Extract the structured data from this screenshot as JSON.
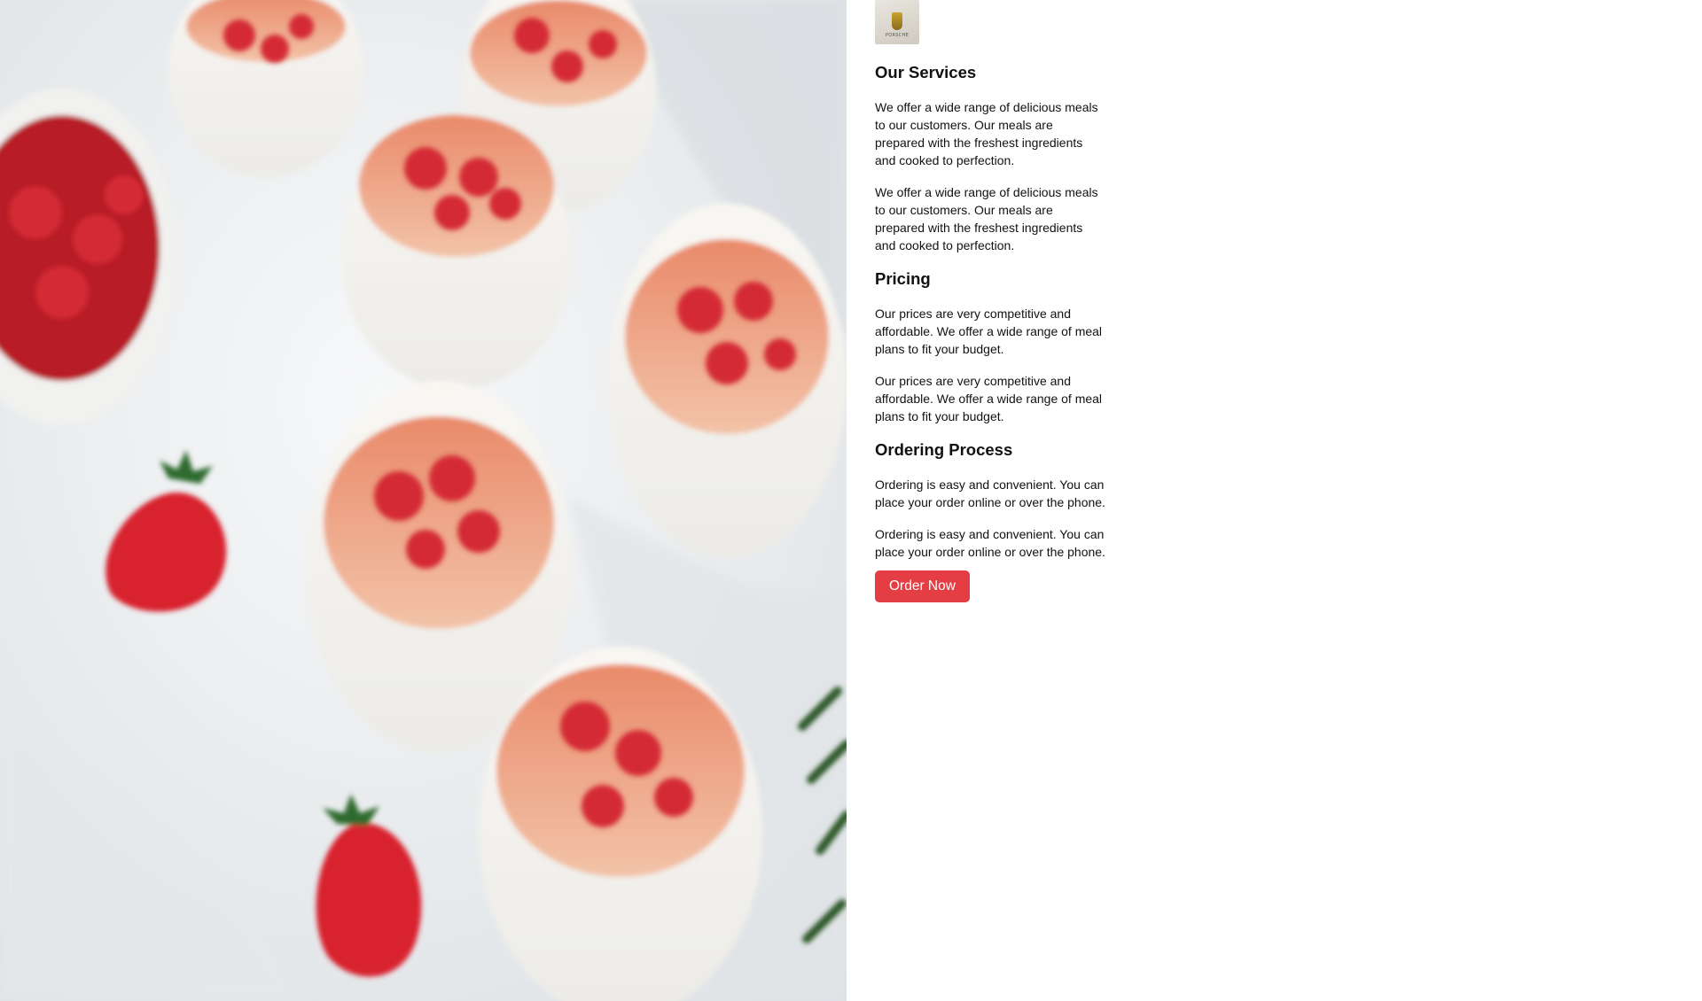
{
  "logo": {
    "alt": "Porsche logo",
    "wordmark": "PORSCHE"
  },
  "sections": [
    {
      "heading": "Our Services",
      "paragraphs": [
        "We offer a wide range of delicious meals to our customers. Our meals are prepared with the freshest ingredients and cooked to perfection.",
        "We offer a wide range of delicious meals to our customers. Our meals are prepared with the freshest ingredients and cooked to perfection."
      ]
    },
    {
      "heading": "Pricing",
      "paragraphs": [
        "Our prices are very competitive and affordable. We offer a wide range of meal plans to fit your budget.",
        "Our prices are very competitive and affordable. We offer a wide range of meal plans to fit your budget."
      ]
    },
    {
      "heading": "Ordering Process",
      "paragraphs": [
        "Ordering is easy and convenient. You can place your order online or over the phone.",
        "Ordering is easy and convenient. You can place your order online or over the phone."
      ]
    }
  ],
  "cta": {
    "label": "Order Now"
  },
  "colors": {
    "button": "#e43d43",
    "button_text": "#ffffff",
    "text": "#111111",
    "background": "#ffffff"
  }
}
